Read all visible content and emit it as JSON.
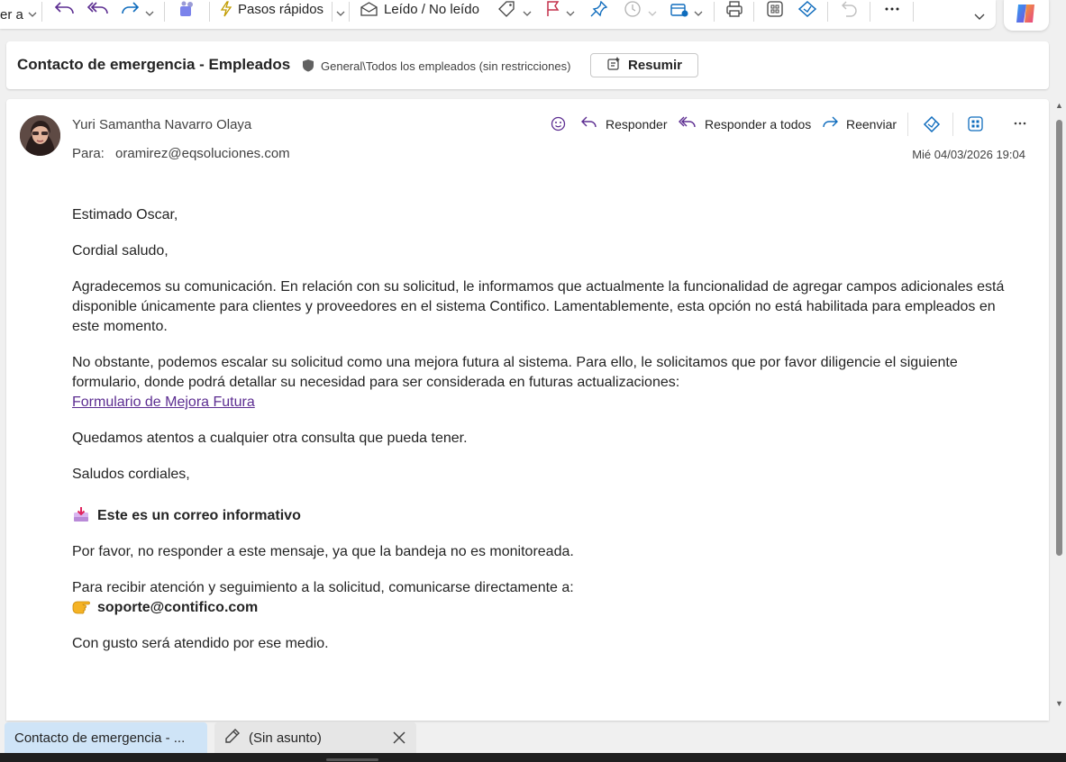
{
  "ribbon": {
    "partial_label": "er a",
    "quick_steps_label": "Pasos rápidos",
    "read_unread_label": "Leído / No leído"
  },
  "subject": {
    "title": "Contacto de emergencia - Empleados",
    "sensitivity_label": "General\\Todos los empleados (sin restricciones)",
    "summarize_label": "Resumir"
  },
  "message": {
    "sender": "Yuri Samantha Navarro Olaya",
    "to_label": "Para:",
    "to_address": "oramirez@eqsoluciones.com",
    "date": "Mié 04/03/2026 19:04",
    "actions": {
      "reply": "Responder",
      "reply_all": "Responder a todos",
      "forward": "Reenviar"
    },
    "body": {
      "greeting": "Estimado Oscar,",
      "salutation": "Cordial saludo,",
      "paragraph1": "Agradecemos su comunicación. En relación con su solicitud, le informamos que actualmente la funcionalidad de agregar campos adicionales está disponible únicamente para clientes y proveedores en el sistema Contifico. Lamentablemente, esta opción no está habilitada para empleados en este momento.",
      "paragraph2": "No obstante, podemos escalar su solicitud como una mejora futura al sistema. Para ello, le solicitamos que por favor diligencie el siguiente formulario, donde podrá detallar su necesidad para ser considerada en futuras actualizaciones:",
      "form_link": "Formulario de Mejora Futura",
      "paragraph3": "Quedamos atentos a cualquier otra consulta que pueda tener.",
      "closing": "Saludos cordiales,",
      "info_heading": "Este es un correo informativo",
      "no_reply": "Por favor, no responder a este mensaje, ya que la bandeja no es monitoreada.",
      "contact_intro": "Para recibir atención y seguimiento a la solicitud, comunicarse directamente a:",
      "support_email": "soporte@contifico.com",
      "final": "Con gusto será atendido por ese medio."
    }
  },
  "tabs": [
    {
      "label": "Contacto de emergencia - ..."
    },
    {
      "label": "(Sin asunto)"
    }
  ],
  "colors": {
    "accent": "#0f6cbd",
    "link": "#5c2d91",
    "flag": "#c4314b",
    "active_tab": "#cfe4f7"
  }
}
